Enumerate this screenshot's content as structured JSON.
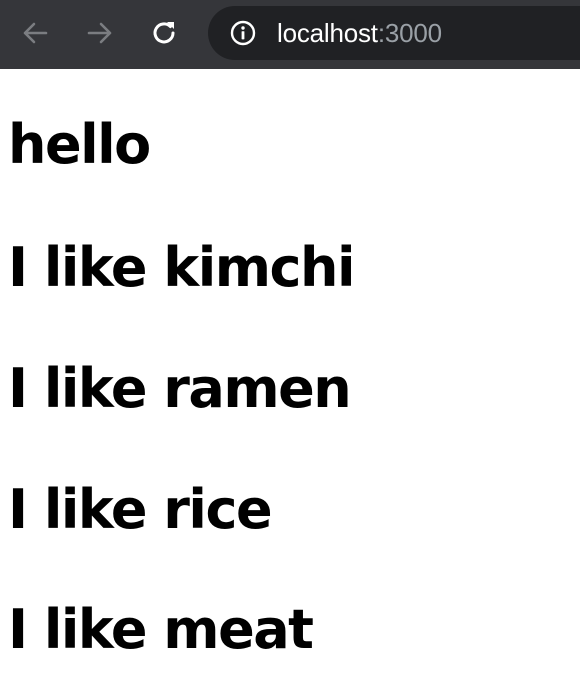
{
  "browser": {
    "toolbar_color": "#35363a",
    "omnibox_color": "#202124",
    "url_host": "localhost",
    "url_port": ":3000",
    "icons": {
      "back": "arrow-left-icon",
      "forward": "arrow-right-icon",
      "reload": "reload-icon",
      "site_info": "info-icon"
    }
  },
  "page": {
    "lines": [
      "hello",
      "I like kimchi",
      "I like ramen",
      "I like rice",
      "I like meat"
    ]
  }
}
